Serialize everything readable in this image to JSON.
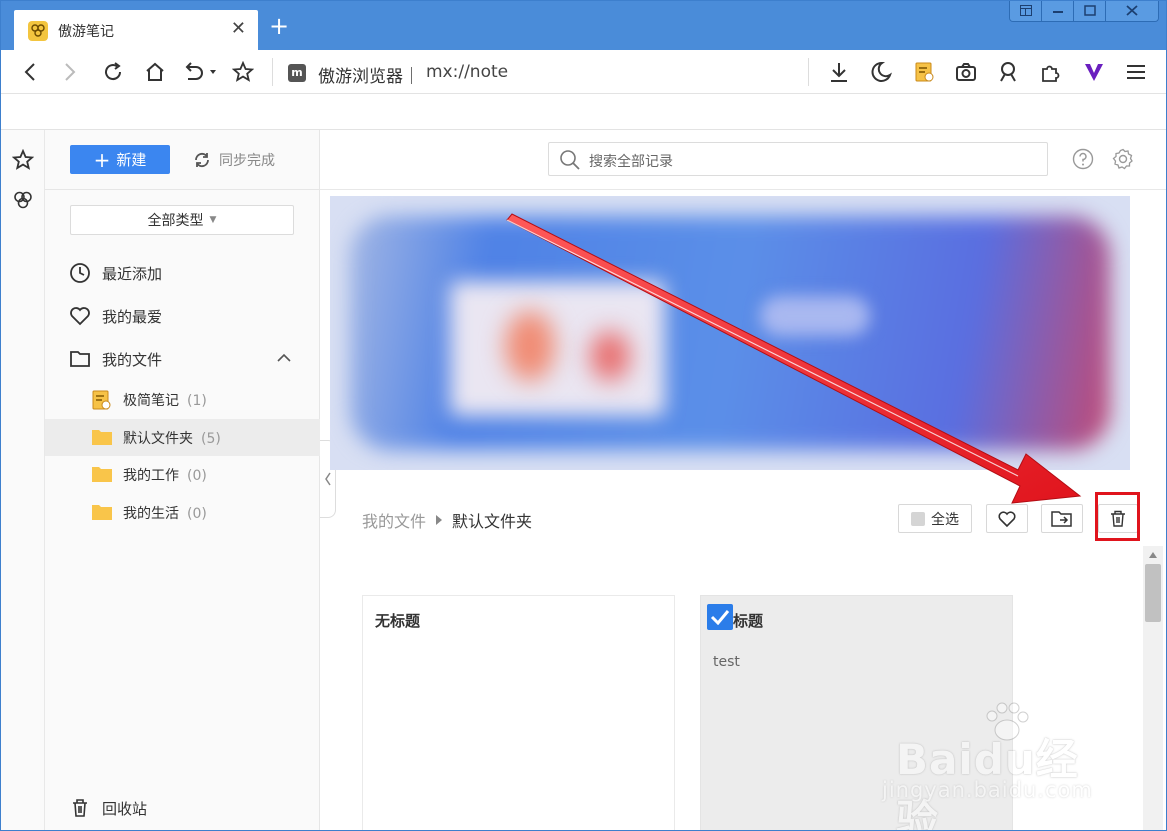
{
  "browser": {
    "tab_title": "傲游笔记",
    "new_tab": "+",
    "site_name": "傲游浏览器｜",
    "url": "mx://note"
  },
  "toolbar": {
    "new_label": "新建",
    "sync_label": "同步完成",
    "search_placeholder": "搜索全部记录"
  },
  "sidebar": {
    "type_filter": "全部类型",
    "items": [
      {
        "label": "最近添加",
        "icon": "clock-icon"
      },
      {
        "label": "我的最爱",
        "icon": "heart-icon"
      },
      {
        "label": "我的文件",
        "icon": "folder-outline-icon"
      }
    ],
    "folders": [
      {
        "label": "极简笔记",
        "count": "(1)"
      },
      {
        "label": "默认文件夹",
        "count": "(5)"
      },
      {
        "label": "我的工作",
        "count": "(0)"
      },
      {
        "label": "我的生活",
        "count": "(0)"
      }
    ],
    "recycle_label": "回收站"
  },
  "content": {
    "breadcrumb_root": "我的文件",
    "breadcrumb_current": "默认文件夹",
    "select_all": "全选",
    "notes": [
      {
        "title": "无标题",
        "body": ""
      },
      {
        "title": "标题",
        "body": "test"
      }
    ]
  },
  "watermark": {
    "brand": "Baidu经验",
    "sub": "jingyan.baidu.com"
  },
  "colors": {
    "titlebar": "#4a8cd9",
    "primary": "#3b86f0",
    "annotation": "#e0141d"
  }
}
